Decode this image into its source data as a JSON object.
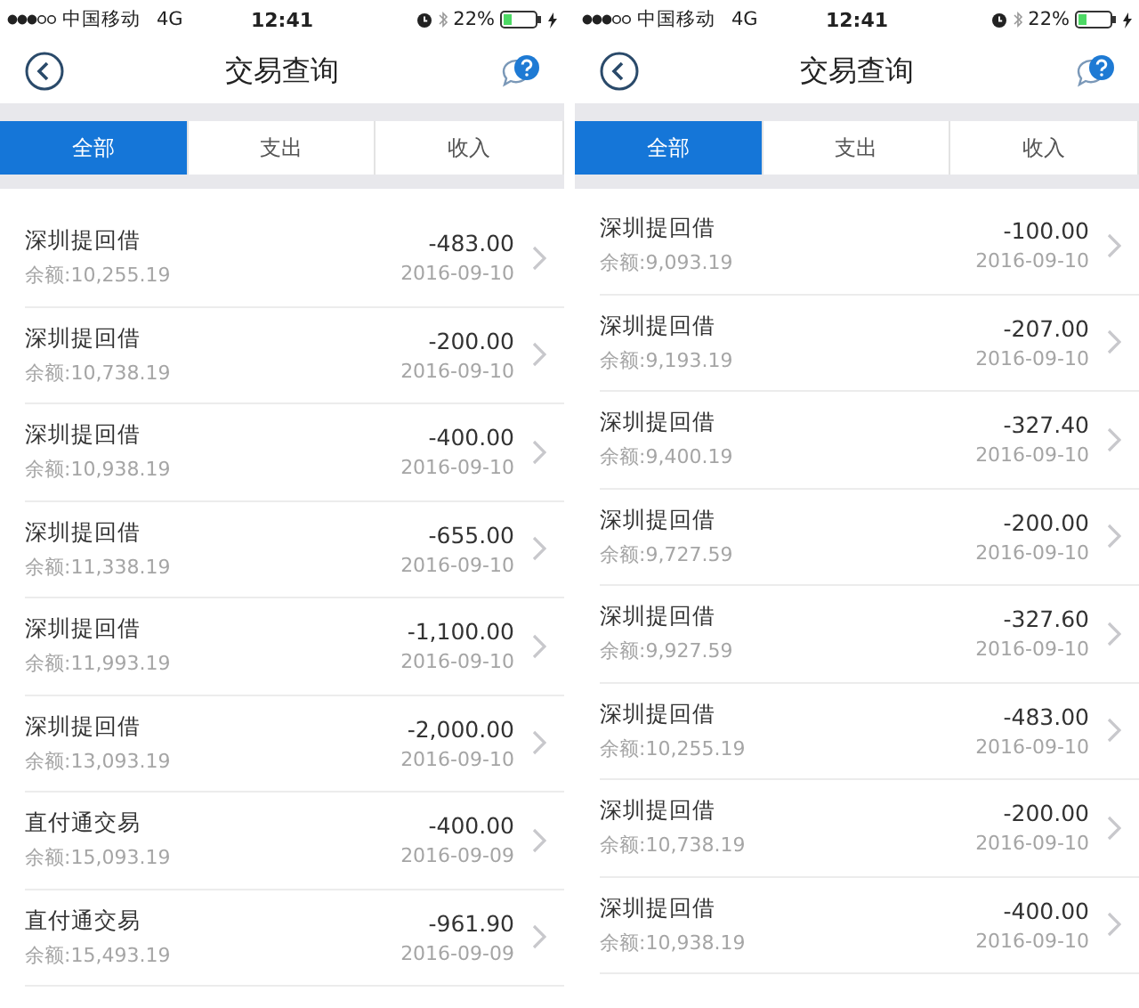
{
  "phones": [
    {
      "status_bar": {
        "carrier": "中国移动",
        "network": "4G",
        "time": "12:41",
        "battery": "22%"
      },
      "title": "交易查询",
      "tabs": [
        {
          "label": "全部",
          "selected": true
        },
        {
          "label": "支出",
          "selected": false
        },
        {
          "label": "收入",
          "selected": false
        }
      ],
      "transactions": [
        {
          "name": "深圳提回借",
          "balance": "余额:10,255.19",
          "amount": "-483.00",
          "date": "2016-09-10"
        },
        {
          "name": "深圳提回借",
          "balance": "余额:10,738.19",
          "amount": "-200.00",
          "date": "2016-09-10"
        },
        {
          "name": "深圳提回借",
          "balance": "余额:10,938.19",
          "amount": "-400.00",
          "date": "2016-09-10"
        },
        {
          "name": "深圳提回借",
          "balance": "余额:11,338.19",
          "amount": "-655.00",
          "date": "2016-09-10"
        },
        {
          "name": "深圳提回借",
          "balance": "余额:11,993.19",
          "amount": "-1,100.00",
          "date": "2016-09-10"
        },
        {
          "name": "深圳提回借",
          "balance": "余额:13,093.19",
          "amount": "-2,000.00",
          "date": "2016-09-10"
        },
        {
          "name": "直付通交易",
          "balance": "余额:15,093.19",
          "amount": "-400.00",
          "date": "2016-09-09"
        },
        {
          "name": "直付通交易",
          "balance": "余额:15,493.19",
          "amount": "-961.90",
          "date": "2016-09-09"
        }
      ]
    },
    {
      "status_bar": {
        "carrier": "中国移动",
        "network": "4G",
        "time": "12:41",
        "battery": "22%"
      },
      "title": "交易查询",
      "tabs": [
        {
          "label": "全部",
          "selected": true
        },
        {
          "label": "支出",
          "selected": false
        },
        {
          "label": "收入",
          "selected": false
        }
      ],
      "transactions": [
        {
          "name": "深圳提回借",
          "balance": "余额:9,093.19",
          "amount": "-100.00",
          "date": "2016-09-10"
        },
        {
          "name": "深圳提回借",
          "balance": "余额:9,193.19",
          "amount": "-207.00",
          "date": "2016-09-10"
        },
        {
          "name": "深圳提回借",
          "balance": "余额:9,400.19",
          "amount": "-327.40",
          "date": "2016-09-10"
        },
        {
          "name": "深圳提回借",
          "balance": "余额:9,727.59",
          "amount": "-200.00",
          "date": "2016-09-10"
        },
        {
          "name": "深圳提回借",
          "balance": "余额:9,927.59",
          "amount": "-327.60",
          "date": "2016-09-10"
        },
        {
          "name": "深圳提回借",
          "balance": "余额:10,255.19",
          "amount": "-483.00",
          "date": "2016-09-10"
        },
        {
          "name": "深圳提回借",
          "balance": "余额:10,738.19",
          "amount": "-200.00",
          "date": "2016-09-10"
        },
        {
          "name": "深圳提回借",
          "balance": "余额:10,938.19",
          "amount": "-400.00",
          "date": "2016-09-10"
        }
      ]
    }
  ]
}
